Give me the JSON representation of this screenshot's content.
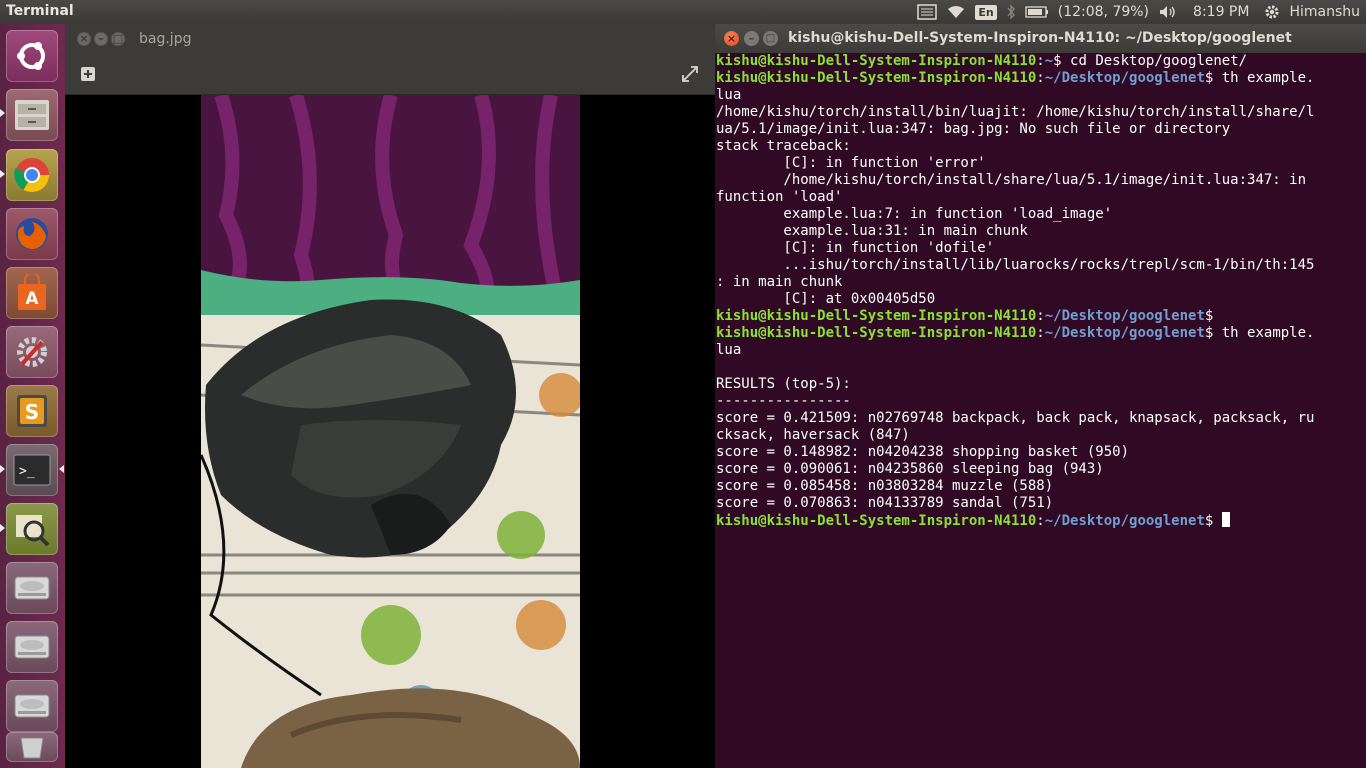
{
  "top_panel": {
    "app_title": "Terminal",
    "lang": "En",
    "battery": "(12:08, 79%)",
    "clock": "8:19 PM",
    "user": "Himanshu",
    "icons": [
      "keyboard-icon",
      "wifi-icon",
      "language-icon",
      "bluetooth-icon",
      "battery-icon",
      "volume-icon",
      "settings-gear-icon"
    ]
  },
  "launcher": {
    "items": [
      "ubuntu-dash",
      "files",
      "chrome",
      "firefox",
      "software-center",
      "system-settings",
      "sublime-text",
      "terminal",
      "image-viewer",
      "drive",
      "drive",
      "drive",
      "trash"
    ]
  },
  "viewer": {
    "title": "bag.jpg"
  },
  "terminal": {
    "title": "kishu@kishu-Dell-System-Inspiron-N4110: ~/Desktop/googlenet",
    "lines": [
      {
        "user": "kishu@kishu-Dell-System-Inspiron-N4110",
        "path": "~",
        "cmd": "$ cd Desktop/googlenet/"
      },
      {
        "user": "kishu@kishu-Dell-System-Inspiron-N4110",
        "path": "~/Desktop/googlenet",
        "cmd": "$ th example."
      },
      {
        "text": "lua"
      },
      {
        "text": "/home/kishu/torch/install/bin/luajit: /home/kishu/torch/install/share/l"
      },
      {
        "text": "ua/5.1/image/init.lua:347: bag.jpg: No such file or directory"
      },
      {
        "text": "stack traceback:"
      },
      {
        "text": "        [C]: in function 'error'"
      },
      {
        "text": "        /home/kishu/torch/install/share/lua/5.1/image/init.lua:347: in"
      },
      {
        "text": "function 'load'"
      },
      {
        "text": "        example.lua:7: in function 'load_image'"
      },
      {
        "text": "        example.lua:31: in main chunk"
      },
      {
        "text": "        [C]: in function 'dofile'"
      },
      {
        "text": "        ...ishu/torch/install/lib/luarocks/rocks/trepl/scm-1/bin/th:145"
      },
      {
        "text": ": in main chunk"
      },
      {
        "text": "        [C]: at 0x00405d50"
      },
      {
        "user": "kishu@kishu-Dell-System-Inspiron-N4110",
        "path": "~/Desktop/googlenet",
        "cmd": "$"
      },
      {
        "user": "kishu@kishu-Dell-System-Inspiron-N4110",
        "path": "~/Desktop/googlenet",
        "cmd": "$ th example."
      },
      {
        "text": "lua"
      },
      {
        "text": ""
      },
      {
        "text": "RESULTS (top-5):"
      },
      {
        "text": "----------------"
      },
      {
        "text": "score = 0.421509: n02769748 backpack, back pack, knapsack, packsack, ru"
      },
      {
        "text": "cksack, haversack (847)"
      },
      {
        "text": "score = 0.148982: n04204238 shopping basket (950)"
      },
      {
        "text": "score = 0.090061: n04235860 sleeping bag (943)"
      },
      {
        "text": "score = 0.085458: n03803284 muzzle (588)"
      },
      {
        "text": "score = 0.070863: n04133789 sandal (751)"
      },
      {
        "user": "kishu@kishu-Dell-System-Inspiron-N4110",
        "path": "~/Desktop/googlenet",
        "cmd": "$ ",
        "cursor": true
      }
    ]
  },
  "colors": {
    "terminal_bg": "#300a24",
    "prompt_user": "#8ae234",
    "prompt_path": "#729fcf",
    "launcher_bg": "#6e2a4e"
  }
}
